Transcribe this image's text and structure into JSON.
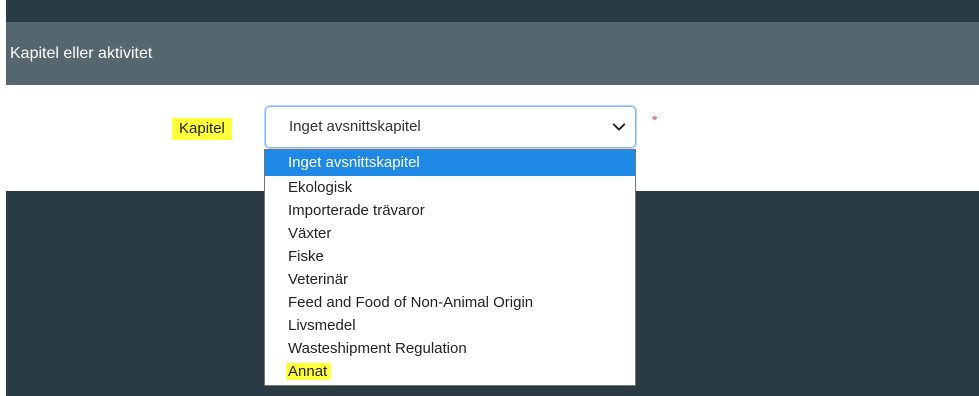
{
  "section": {
    "title": "Kapitel eller aktivitet"
  },
  "form": {
    "label": "Kapitel",
    "required_mark": "*",
    "selected_value": "Inget avsnittskapitel"
  },
  "dropdown": {
    "options": [
      "Inget avsnittskapitel",
      "Ekologisk",
      "Importerade trävaror",
      "Växter",
      "Fiske",
      "Veterinär",
      "Feed and Food of Non-Animal Origin",
      "Livsmedel",
      "Wasteshipment Regulation",
      "Annat"
    ]
  },
  "colors": {
    "top_bar": "#2b3b44",
    "section_header": "#56666f",
    "highlight": "#ffff3c",
    "selected_option": "#1e88e5",
    "required": "#d9534f"
  },
  "icons": {
    "select_chevron": "chevron-down-icon"
  }
}
